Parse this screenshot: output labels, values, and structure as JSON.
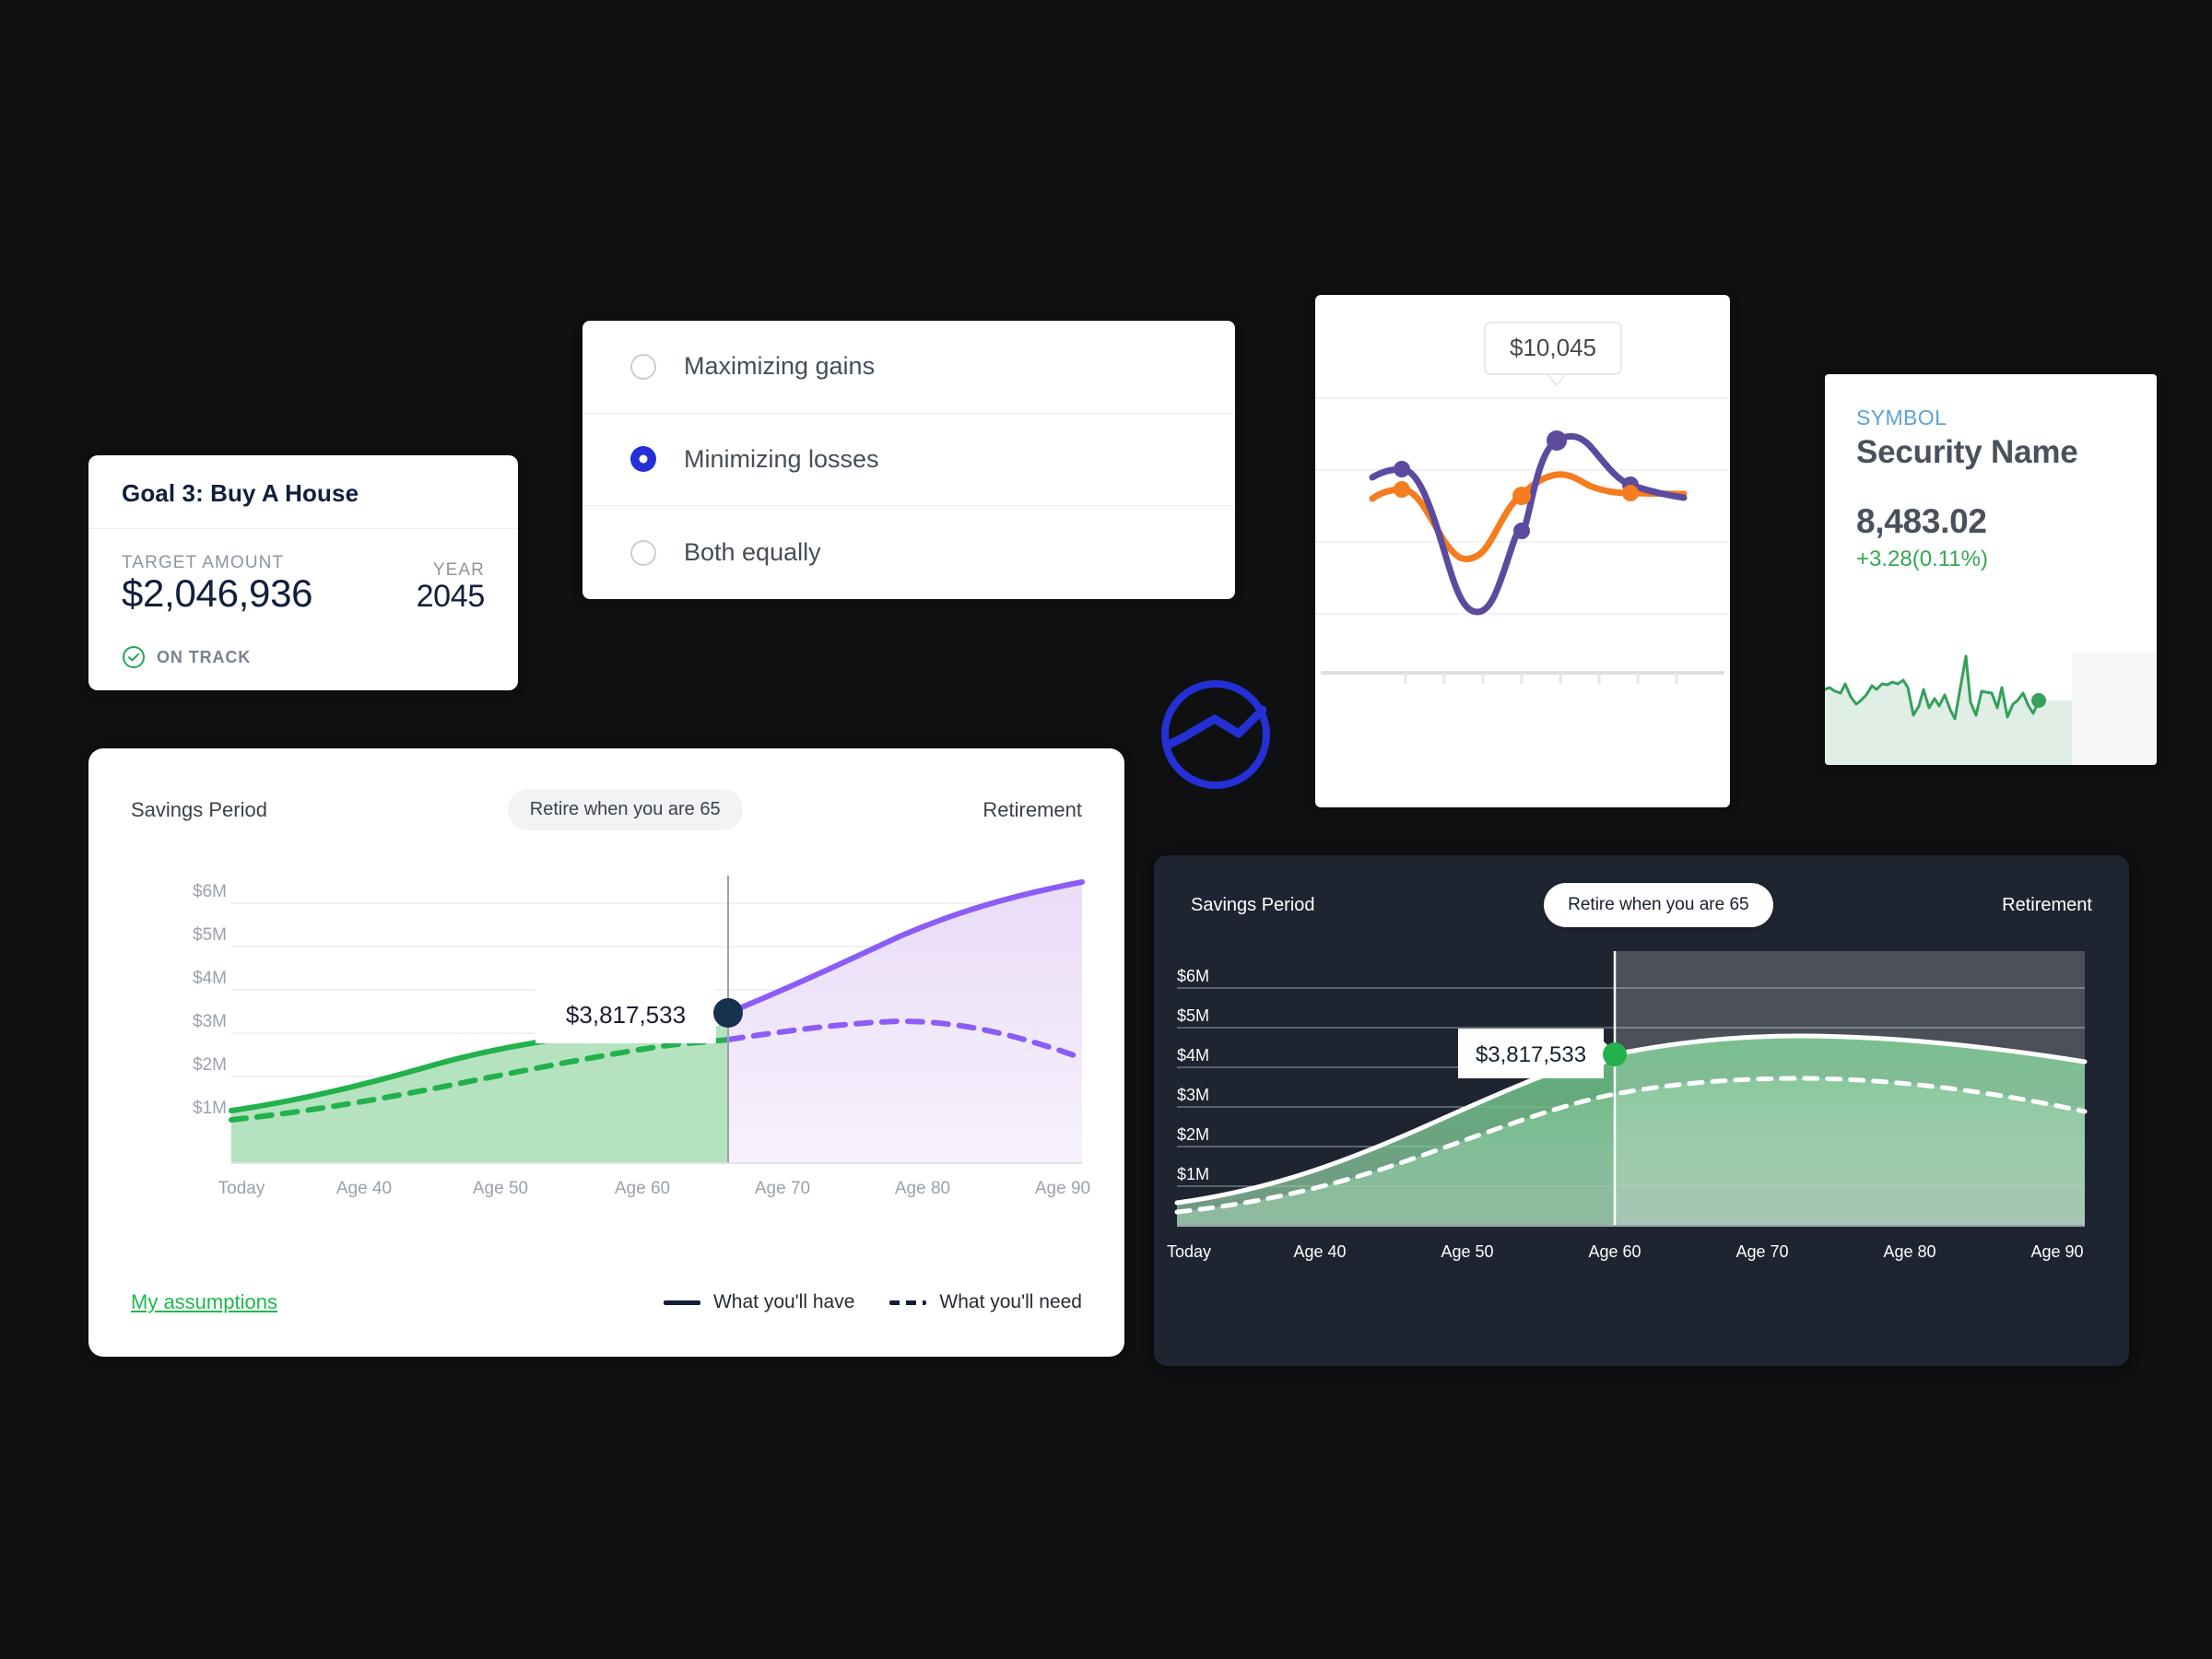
{
  "background_color": "#0e1011",
  "goal_card": {
    "title": "Goal 3: Buy A House",
    "target_label": "TARGET AMOUNT",
    "target_value": "$2,046,936",
    "year_label": "YEAR",
    "year_value": "2045",
    "status": "ON TRACK",
    "status_color": "#22a757"
  },
  "choice_card": {
    "options": [
      {
        "label": "Maximizing gains",
        "selected": false
      },
      {
        "label": "Minimizing losses",
        "selected": true
      },
      {
        "label": "Both equally",
        "selected": false
      }
    ],
    "accent_color": "#2430d6"
  },
  "logo": {
    "name": "chart-mark-logo",
    "color": "#2430d6"
  },
  "security_card": {
    "symbol": "SYMBOL",
    "name": "Security Name",
    "price": "8,483.02",
    "change": "+3.28(0.11%)",
    "change_color": "#34a853",
    "line_color": "#34a05a"
  },
  "savings_light": {
    "left_label": "Savings Period",
    "pill_label": "Retire when you are 65",
    "right_label": "Retirement",
    "tooltip_value": "$3,817,533",
    "assumptions_link": "My assumptions",
    "legend": [
      {
        "label": "What you'll have",
        "style": "solid"
      },
      {
        "label": "What you'll need",
        "style": "dashed"
      }
    ],
    "colors": {
      "have_savings": "#22b14c",
      "have_retirement": "#8B5CF6",
      "fill_savings": "#b5e3c0",
      "fill_retirement": "#efe7f9",
      "marker": "#17314f"
    }
  },
  "savings_dark": {
    "left_label": "Savings Period",
    "pill_label": "Retire when you are 65",
    "right_label": "Retirement",
    "tooltip_value": "$3,817,533",
    "colors": {
      "card": "#1e2530",
      "line": "#ffffff",
      "marker": "#22b14c",
      "retirement_overlay": "rgba(255,255,255,0.20)"
    }
  },
  "stock_card": {
    "tooltip_value": "$10,045",
    "series_colors": {
      "primary": "#5b4a9e",
      "secondary": "#f57c1f"
    }
  },
  "chart_data": [
    {
      "type": "area",
      "name": "savings-projection-light",
      "title": "Savings Period / Retirement",
      "xlabel": "",
      "ylabel": "",
      "x": [
        "Today",
        "Age 40",
        "Age 50",
        "Age 60",
        "Age 70",
        "Age 80",
        "Age 90"
      ],
      "ylim": [
        0,
        6500000
      ],
      "yticks": [
        "$1M",
        "$2M",
        "$3M",
        "$4M",
        "$5M",
        "$6M"
      ],
      "grid": true,
      "legend": [
        "What you'll have",
        "What you'll need"
      ],
      "annotations": [
        {
          "text": "$3,817,533",
          "at_age": 65,
          "value": 3817533
        },
        {
          "text": "Retire when you are 65",
          "at_age": 65
        }
      ],
      "series": [
        {
          "name": "What you'll have",
          "style": "solid",
          "points": [
            {
              "x": "Today",
              "y": 700000
            },
            {
              "x": "Age 40",
              "y": 1000000
            },
            {
              "x": "Age 50",
              "y": 1800000
            },
            {
              "x": "Age 60",
              "y": 3000000
            },
            {
              "x": "Age 65",
              "y": 3817533
            },
            {
              "x": "Age 70",
              "y": 4350000
            },
            {
              "x": "Age 80",
              "y": 5300000
            },
            {
              "x": "Age 90",
              "y": 6400000
            }
          ]
        },
        {
          "name": "What you'll need",
          "style": "dashed",
          "points": [
            {
              "x": "Today",
              "y": 620000
            },
            {
              "x": "Age 40",
              "y": 900000
            },
            {
              "x": "Age 50",
              "y": 1450000
            },
            {
              "x": "Age 60",
              "y": 2450000
            },
            {
              "x": "Age 65",
              "y": 2850000
            },
            {
              "x": "Age 70",
              "y": 3180000
            },
            {
              "x": "Age 80",
              "y": 3250000
            },
            {
              "x": "Age 90",
              "y": 2680000
            }
          ]
        }
      ]
    },
    {
      "type": "area",
      "name": "savings-projection-dark",
      "title": "Savings Period / Retirement",
      "x": [
        "Today",
        "Age 40",
        "Age 50",
        "Age 60",
        "Age 70",
        "Age 80",
        "Age 90"
      ],
      "ylim": [
        0,
        6500000
      ],
      "yticks": [
        "$1M",
        "$2M",
        "$3M",
        "$4M",
        "$5M",
        "$6M"
      ],
      "grid": true,
      "annotations": [
        {
          "text": "$3,817,533",
          "at_age": 65,
          "value": 3817533
        },
        {
          "text": "Retire when you are 65",
          "at_age": 65
        }
      ],
      "series": [
        {
          "name": "What you'll have",
          "style": "solid",
          "points": [
            {
              "x": "Today",
              "y": 750000
            },
            {
              "x": "Age 40",
              "y": 1250000
            },
            {
              "x": "Age 50",
              "y": 2200000
            },
            {
              "x": "Age 60",
              "y": 3350000
            },
            {
              "x": "Age 65",
              "y": 3817533
            },
            {
              "x": "Age 70",
              "y": 4150000
            },
            {
              "x": "Age 80",
              "y": 4300000
            },
            {
              "x": "Age 90",
              "y": 4050000
            }
          ]
        },
        {
          "name": "What you'll need",
          "style": "dashed",
          "points": [
            {
              "x": "Today",
              "y": 600000
            },
            {
              "x": "Age 40",
              "y": 950000
            },
            {
              "x": "Age 50",
              "y": 1650000
            },
            {
              "x": "Age 60",
              "y": 2500000
            },
            {
              "x": "Age 65",
              "y": 2820000
            },
            {
              "x": "Age 70",
              "y": 3050000
            },
            {
              "x": "Age 80",
              "y": 3050000
            },
            {
              "x": "Age 90",
              "y": 2500000
            }
          ]
        }
      ]
    },
    {
      "type": "line",
      "name": "stock-comparison",
      "title": "",
      "grid": true,
      "annotations": [
        {
          "text": "$10,045",
          "series": "primary"
        }
      ],
      "series": [
        {
          "name": "primary",
          "color": "#5b4a9e",
          "values": [
            0.6,
            0.63,
            0.45,
            0.14,
            0.08,
            0.33,
            0.9,
            0.88,
            0.76,
            0.73,
            0.71
          ]
        },
        {
          "name": "secondary",
          "color": "#f57c1f",
          "values": [
            0.5,
            0.52,
            0.4,
            0.28,
            0.3,
            0.57,
            0.66,
            0.64,
            0.57,
            0.55,
            0.55
          ]
        }
      ]
    },
    {
      "type": "area",
      "name": "security-sparkline",
      "color": "#34a05a",
      "values": [
        0.58,
        0.56,
        0.52,
        0.5,
        0.66,
        0.44,
        0.34,
        0.4,
        0.48,
        0.64,
        0.58,
        0.68,
        0.66,
        0.7,
        0.68,
        0.72,
        0.62,
        0.18,
        0.28,
        0.58,
        0.34,
        0.46,
        0.36,
        0.52,
        0.3,
        0.16,
        0.6,
        1.0,
        0.44,
        0.24,
        0.56,
        0.55,
        0.54,
        0.3,
        0.62,
        0.18,
        0.36,
        0.4,
        0.52,
        0.34,
        0.22,
        0.4
      ]
    }
  ]
}
